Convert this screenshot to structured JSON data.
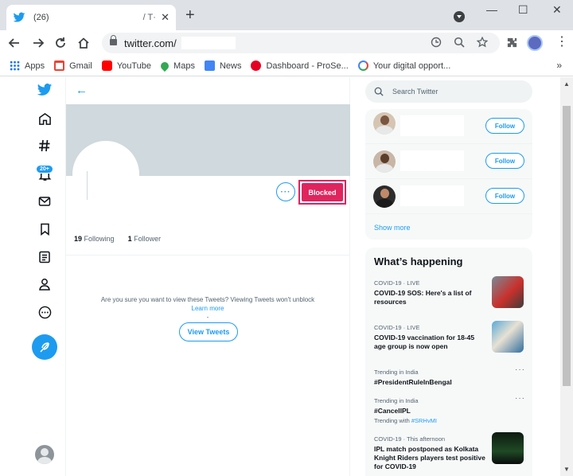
{
  "browser": {
    "tab_title": "(26)",
    "tab_separator": "/ T·",
    "tab_close": "✕",
    "new_tab": "+",
    "window_minimize": "—",
    "window_maximize": "☐",
    "window_close": "✕",
    "url": "twitter.com/",
    "menu": "⋮",
    "bookmarks": [
      {
        "label": "Apps",
        "icon": "apps-grid-icon",
        "color": "#1a73e8"
      },
      {
        "label": "Gmail",
        "icon": "gmail-icon",
        "color": "#ea4335"
      },
      {
        "label": "YouTube",
        "icon": "youtube-icon",
        "color": "#ff0000"
      },
      {
        "label": "Maps",
        "icon": "maps-icon",
        "color": "#34a853"
      },
      {
        "label": "News",
        "icon": "news-icon",
        "color": "#4285f4"
      },
      {
        "label": "Dashboard - ProSe...",
        "icon": "pinterest-icon",
        "color": "#e60023"
      },
      {
        "label": "Your digital opport...",
        "icon": "google-icon",
        "color": "#4285f4"
      }
    ],
    "bookmarks_more": "»"
  },
  "twitter": {
    "accent": "#1d9bf0",
    "blocked_color": "#e0245e",
    "nav_badge": "20+",
    "profile": {
      "back": "←",
      "more": "···",
      "blocked_label": "Blocked",
      "following_count": "19",
      "following_label": "Following",
      "followers_count": "1",
      "followers_label": "Follower",
      "warning_text": "Are you sure you want to view these Tweets? Viewing Tweets won't unblock",
      "learn_more": "Learn more",
      "warning_dash": "-",
      "view_tweets": "View Tweets"
    },
    "sidebar": {
      "search_placeholder": "Search Twitter",
      "follow_label": "Follow",
      "show_more": "Show more",
      "happening_title": "What’s happening",
      "trends": [
        {
          "meta": "COVID-19 · LIVE",
          "text": "COVID-19 SOS: Here's a list of resources",
          "extra": ""
        },
        {
          "meta": "COVID-19 · LIVE",
          "text": "COVID-19 vaccination for 18-45 age group is now open",
          "extra": ""
        },
        {
          "meta": "Trending in India",
          "text": "#PresidentRuleInBengal",
          "extra": ""
        },
        {
          "meta": "Trending in India",
          "text": "#CancelIPL",
          "extra_prefix": "Trending with",
          "extra_tag": "#SRHvMI"
        },
        {
          "meta": "COVID-19 · This afternoon",
          "text": "IPL match postponed as Kolkata Knight Riders players test positive for COVID-19",
          "extra": ""
        }
      ],
      "trend_more": "···"
    }
  }
}
